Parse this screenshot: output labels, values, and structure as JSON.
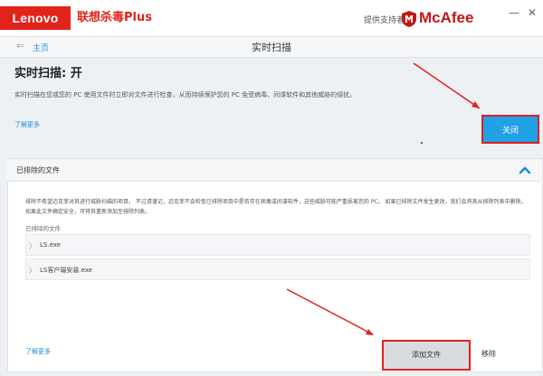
{
  "titlebar": {
    "brand": "Lenovo",
    "product": "联想杀毒Plus",
    "provided_by": "提供支持者",
    "partner": "McAfee",
    "window_controls": [
      "minimize-icon",
      "close-icon"
    ]
  },
  "nav": {
    "back_icon": "back-arrow-icon",
    "home": "主页",
    "title": "实时扫描"
  },
  "scan": {
    "heading": "实时扫描: 开",
    "description": "实时扫描在您或您的 PC 使用文件时立即对文件进行检查，从而持续保护您的 PC 免受病毒、间谍软件和其他威胁的侵扰。",
    "learn_more": "了解更多",
    "close_button": "关闭"
  },
  "excluded": {
    "title": "已排除的文件",
    "description": "排除不希望迈克菲对其进行威胁扫描的项目。 不过请谨记，迈克菲不会检查已排除项目中是否存在病毒或间谍软件，这些威胁可能严重损害您的 PC。 如果已排除文件发生更改，我们会将其从排除列表中删除。 如果此文件确定安全，可将其重新添加至排除列表。",
    "list_label": "已排除的文件",
    "files": [
      "LS.exe",
      "LS客户端安装.exe"
    ],
    "learn_more": "了解更多",
    "add_file_button": "添加文件",
    "remove_button": "移除"
  },
  "colors": {
    "lenovo_red": "#e2231a",
    "accent_blue": "#21a1e6",
    "annotation_red": "#e02020"
  }
}
